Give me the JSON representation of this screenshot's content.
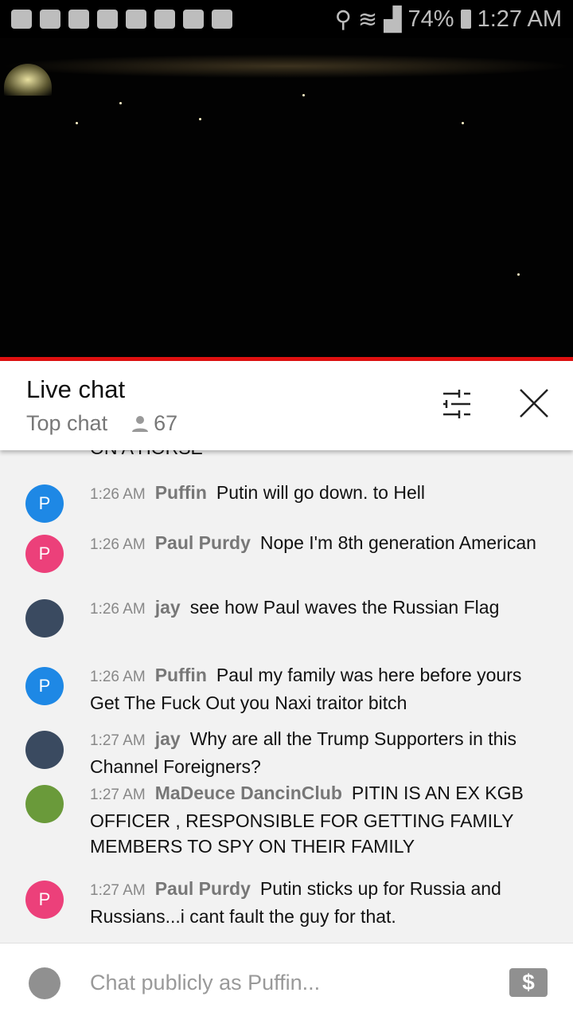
{
  "status_bar": {
    "battery": "74%",
    "time": "1:27 AM"
  },
  "header": {
    "title": "Live chat",
    "mode": "Top chat",
    "viewer_count": "67"
  },
  "partial_message": "ON A HORSE",
  "messages": [
    {
      "time": "1:26 AM",
      "author": "Puffin",
      "text": "Putin will go down. to Hell",
      "avatar_letter": "P",
      "avatar_color": "#1e88e5"
    },
    {
      "time": "1:26 AM",
      "author": "Paul Purdy",
      "text": "Nope I'm 8th generation American",
      "avatar_letter": "P",
      "avatar_color": "#ec407a"
    },
    {
      "time": "1:26 AM",
      "author": "jay",
      "text": "see how Paul waves the Russian Flag",
      "avatar_letter": "",
      "avatar_color": "#3a4a60"
    },
    {
      "time": "1:26 AM",
      "author": "Puffin",
      "text": "Paul my family was here before yours Get The Fuck Out you Naxi traitor bitch",
      "avatar_letter": "P",
      "avatar_color": "#1e88e5"
    },
    {
      "time": "1:27 AM",
      "author": "jay",
      "text": "Why are all the Trump Supporters in this Channel Foreigners?",
      "avatar_letter": "",
      "avatar_color": "#3a4a60"
    },
    {
      "time": "1:27 AM",
      "author": "MaDeuce DancinClub",
      "text": "PITIN IS AN EX KGB OFFICER , RESPONSIBLE FOR GETTING FAMILY MEMBERS TO SPY ON THEIR FAMILY",
      "avatar_letter": "",
      "avatar_color": "#6a9a3a"
    },
    {
      "time": "1:27 AM",
      "author": "Paul Purdy",
      "text": "Putin sticks up for Russia and Russians...i cant fault the guy for that.",
      "avatar_letter": "P",
      "avatar_color": "#ec407a"
    }
  ],
  "input": {
    "placeholder": "Chat publicly as Puffin..."
  }
}
